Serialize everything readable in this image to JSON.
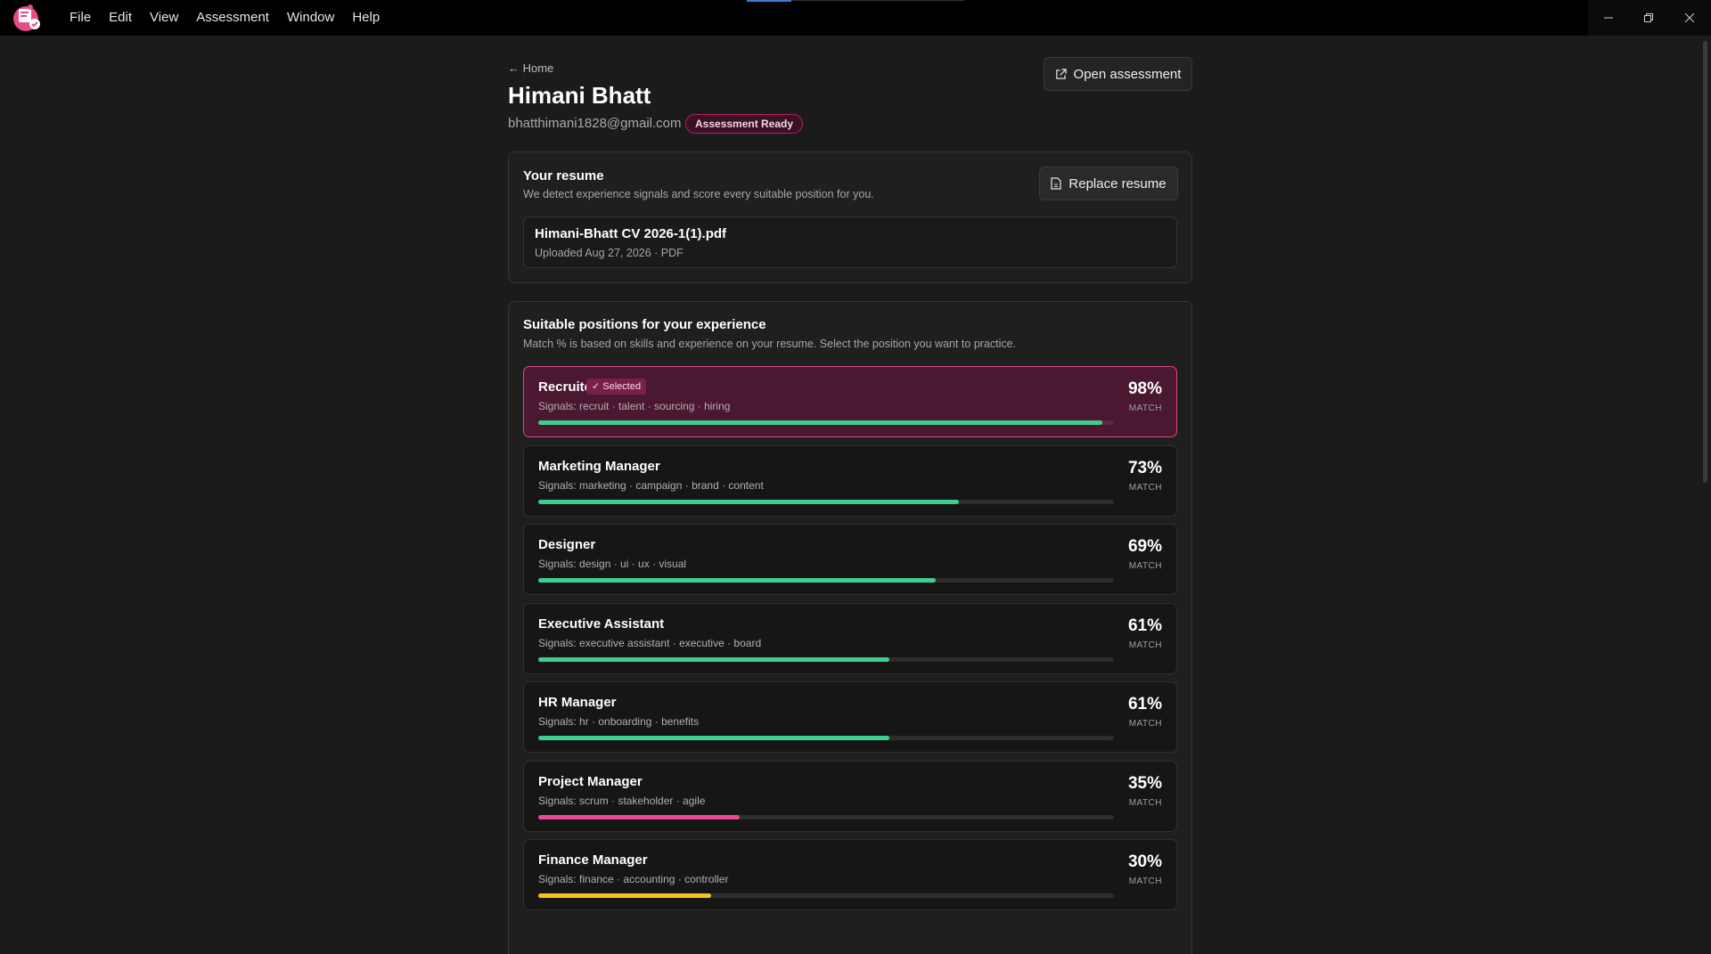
{
  "menu": [
    "File",
    "Edit",
    "View",
    "Assessment",
    "Window",
    "Help"
  ],
  "header": {
    "back_label": "← Home",
    "name": "Himani Bhatt",
    "email": "bhatthimani1828@gmail.com",
    "status": "Assessment Ready",
    "open_button": "Open assessment"
  },
  "resume": {
    "title": "Your resume",
    "subtitle": "We detect experience signals and score every suitable position for you.",
    "replace_button": "Replace resume",
    "file_name": "Himani-Bhatt CV 2026-1(1).pdf",
    "file_meta": "Uploaded Aug 27, 2026 · PDF"
  },
  "positions": {
    "title": "Suitable positions for your experience",
    "subtitle": "Match % is based on skills and experience on your resume. Select the position you want to practice.",
    "selected_label": "Selected",
    "match_label": "MATCH",
    "items": [
      {
        "name": "Recruiter",
        "signals": "Signals: recruit · talent · sourcing · hiring",
        "pct": "98%",
        "value": 98,
        "color": "#3ecf8e",
        "selected": true
      },
      {
        "name": "Marketing Manager",
        "signals": "Signals: marketing · campaign · brand · content",
        "pct": "73%",
        "value": 73,
        "color": "#3ecf8e",
        "selected": false
      },
      {
        "name": "Designer",
        "signals": "Signals: design · ui · ux · visual",
        "pct": "69%",
        "value": 69,
        "color": "#3ecf8e",
        "selected": false
      },
      {
        "name": "Executive Assistant",
        "signals": "Signals: executive assistant · executive · board",
        "pct": "61%",
        "value": 61,
        "color": "#3ecf8e",
        "selected": false
      },
      {
        "name": "HR Manager",
        "signals": "Signals: hr · onboarding · benefits",
        "pct": "61%",
        "value": 61,
        "color": "#3ecf8e",
        "selected": false
      },
      {
        "name": "Project Manager",
        "signals": "Signals: scrum · stakeholder · agile",
        "pct": "35%",
        "value": 35,
        "color": "#ec4899",
        "selected": false
      },
      {
        "name": "Finance Manager",
        "signals": "Signals: finance · accounting · controller",
        "pct": "30%",
        "value": 30,
        "color": "#f5c518",
        "selected": false
      }
    ]
  },
  "colors": {
    "accent_pink": "#e1458a",
    "good": "#3ecf8e",
    "warn": "#f5c518",
    "low": "#ec4899"
  },
  "icons": [
    "app-logo-icon",
    "external-link-icon",
    "document-icon",
    "check-icon",
    "minimize-icon",
    "restore-icon",
    "close-icon"
  ]
}
